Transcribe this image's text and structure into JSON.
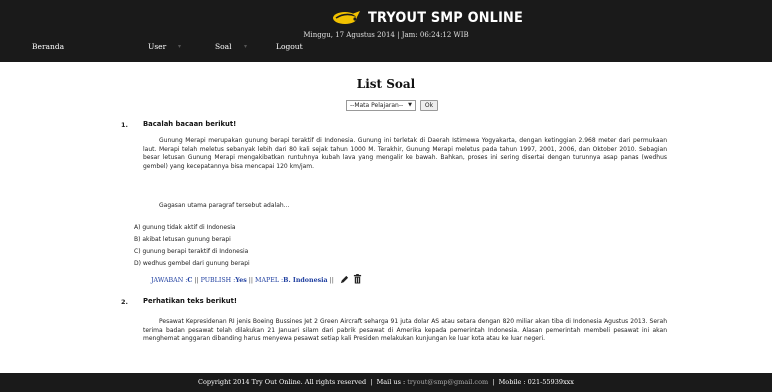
{
  "header": {
    "logo_text": "TRYOUT SMP ONLINE",
    "datetime": "Minggu, 17 Agustus 2014 | Jam: 06:24:12 WIB",
    "nav": [
      "Beranda",
      "User",
      "Soal",
      "Logout"
    ]
  },
  "page_title": "List Soal",
  "filter": {
    "select_value": "--Mata Pelajaran--",
    "ok_label": "Ok"
  },
  "questions": [
    {
      "number": "1.",
      "heading": "Bacalah bacaan berikut!",
      "paragraph": "Gunung Merapi merupakan gunung berapi  teraktif di Indonesia. Gunung ini terletak di Daerah Istimewa Yogyakarta, dengan ketinggian 2.968 meter dari permukaan laut. Merapi telah meletus sebanyak lebih dari 80 kali sejak tahun 1000 M. Terakhir, Gunung Merapi meletus pada tahun 1997, 2001, 2006, dan Oktober 2010. Sebagian besar letusan Gunung Merapi mengakibatkan runtuhnya kubah lava yang mengalir ke bawah. Bahkan, proses ini sering disertai dengan turunnya asap panas (wedhus gembel) yang kecepatannya bisa mencapai 120 km/jam.",
      "prompt": "Gagasan utama paragraf tersebut adalah...",
      "options": [
        "A) gunung tidak aktif di Indonesia",
        "B) akibat letusan gunung berapi",
        "C) gunung berapi teraktif di Indonesia",
        "D) wedhus gembel dari gunung berapi"
      ],
      "meta": {
        "jawaban_label": "JAWABAN : ",
        "jawaban": "C",
        "publish_label": "PUBLISH : ",
        "publish": "Yes",
        "mapel_label": "MAPEL : ",
        "mapel": "B. Indonesia"
      }
    },
    {
      "number": "2.",
      "heading": "Perhatikan teks berikut!",
      "paragraph": "Pesawat Kepresidenan RI jenis Boeing Bussines Jet 2 Green Aircraft seharga 91 juta dolar AS atau setara dengan 820 miliar akan tiba di Indonesia Agustus 2013. Serah terima badan pesawat telah dilakukan 21 Januari silam dari pabrik pesawat di Amerika kepada pemerintah Indonesia. Alasan pemerintah membeli pesawat ini akan menghemat anggaran dibanding harus menyewa pesawat setiap kali Presiden melakukan kunjungan ke luar kota atau ke luar negeri."
    }
  ],
  "footer": {
    "copyright": "Copyright 2014 Try Out Online. All rights reserved",
    "mail_label": "Mail us : ",
    "mail": "tryout@smp@gmail.com",
    "mobile": "Mobile : 021-55939xxx"
  },
  "colors": {
    "header_bg": "#1a1a1a",
    "link_blue": "#1f3fa0",
    "logo_yellow": "#f2c200"
  }
}
